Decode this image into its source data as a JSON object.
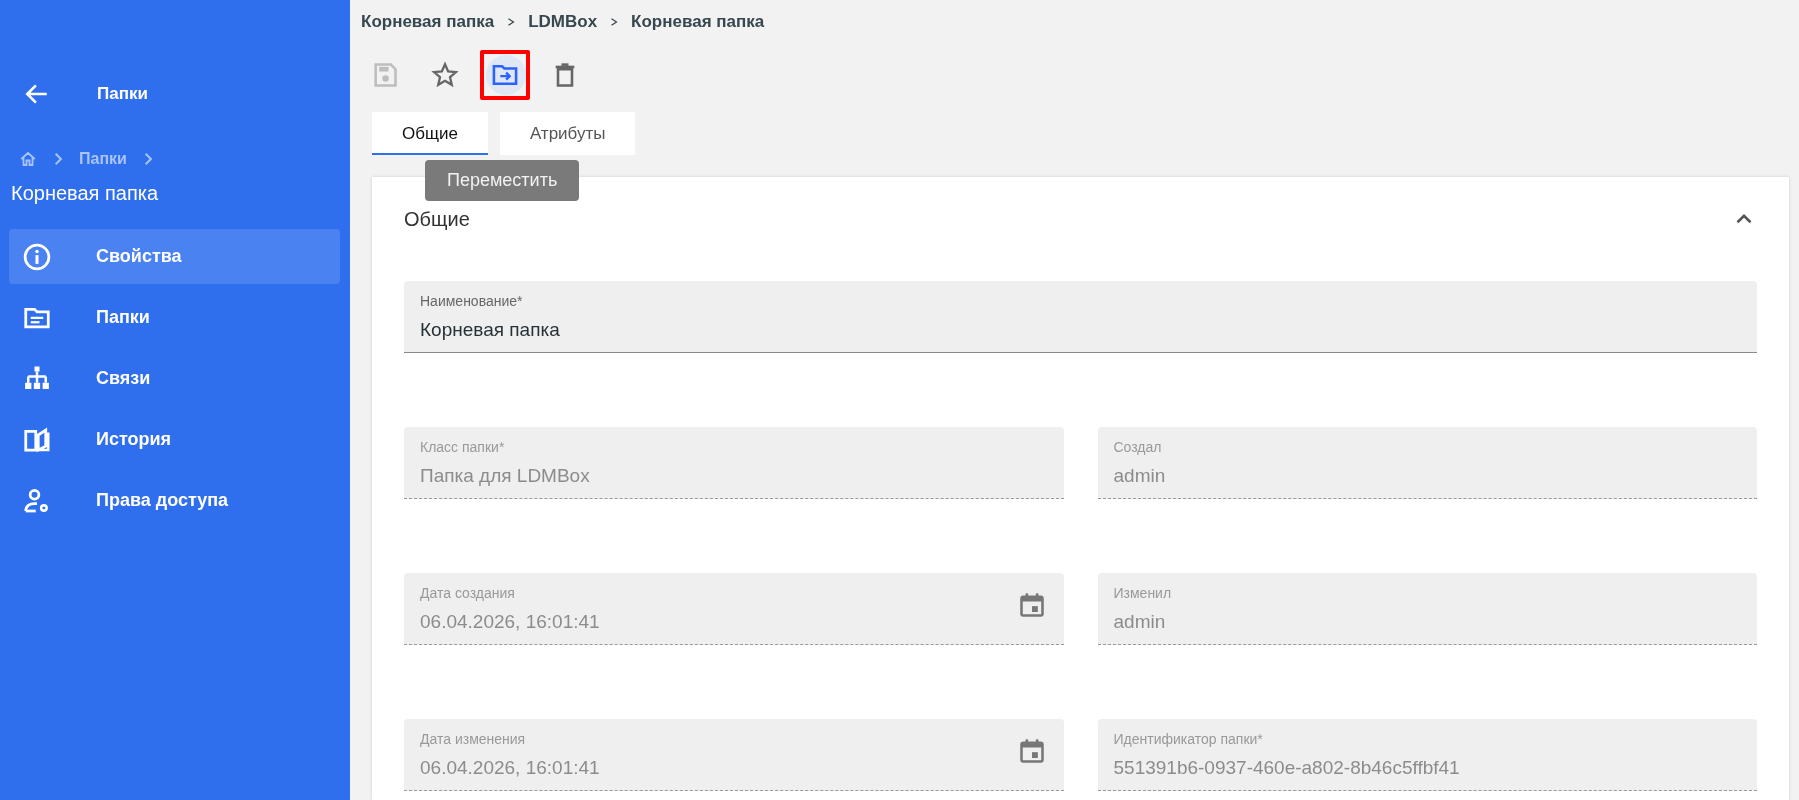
{
  "sidebar": {
    "header": {
      "title": "Папки"
    },
    "breadcrumb": [
      "Папки"
    ],
    "title": "Корневая папка",
    "items": [
      {
        "label": "Свойства",
        "selected": true
      },
      {
        "label": "Папки",
        "selected": false
      },
      {
        "label": "Связи",
        "selected": false
      },
      {
        "label": "История",
        "selected": false
      },
      {
        "label": "Права доступа",
        "selected": false
      }
    ]
  },
  "breadcrumb": [
    "Корневая папка",
    "LDMBox",
    "Корневая папка"
  ],
  "toolbar": [
    {
      "disabled": true,
      "focused": false
    },
    {
      "disabled": false,
      "focused": false
    },
    {
      "disabled": false,
      "focused": true,
      "tooltip": "Переместить"
    },
    {
      "disabled": false,
      "focused": false
    }
  ],
  "tabs": [
    {
      "label": "Общие",
      "selected": true
    },
    {
      "label": "Атрибуты",
      "selected": false
    }
  ],
  "section": {
    "title": "Общие",
    "expanded": true,
    "fields": [
      {
        "label": "Наименование*",
        "value": "Корневая папка",
        "disabled": false,
        "kind": "text"
      },
      {
        "label": "Класс папки*",
        "value": "Папка для LDMBox",
        "disabled": true,
        "kind": "text"
      },
      {
        "label": "Создал",
        "value": "admin",
        "disabled": true,
        "kind": "text"
      },
      {
        "label": "Дата создания",
        "value": "06.04.2026, 16:01:41",
        "disabled": true,
        "kind": "date"
      },
      {
        "label": "Изменил",
        "value": "admin",
        "disabled": true,
        "kind": "text"
      },
      {
        "label": "Дата изменения",
        "value": "06.04.2026, 16:01:41",
        "disabled": true,
        "kind": "date"
      },
      {
        "label": "Идентификатор папки*",
        "value": "551391b6-0937-460e-a802-8b46c5ffbf41",
        "disabled": true,
        "kind": "text"
      }
    ]
  }
}
